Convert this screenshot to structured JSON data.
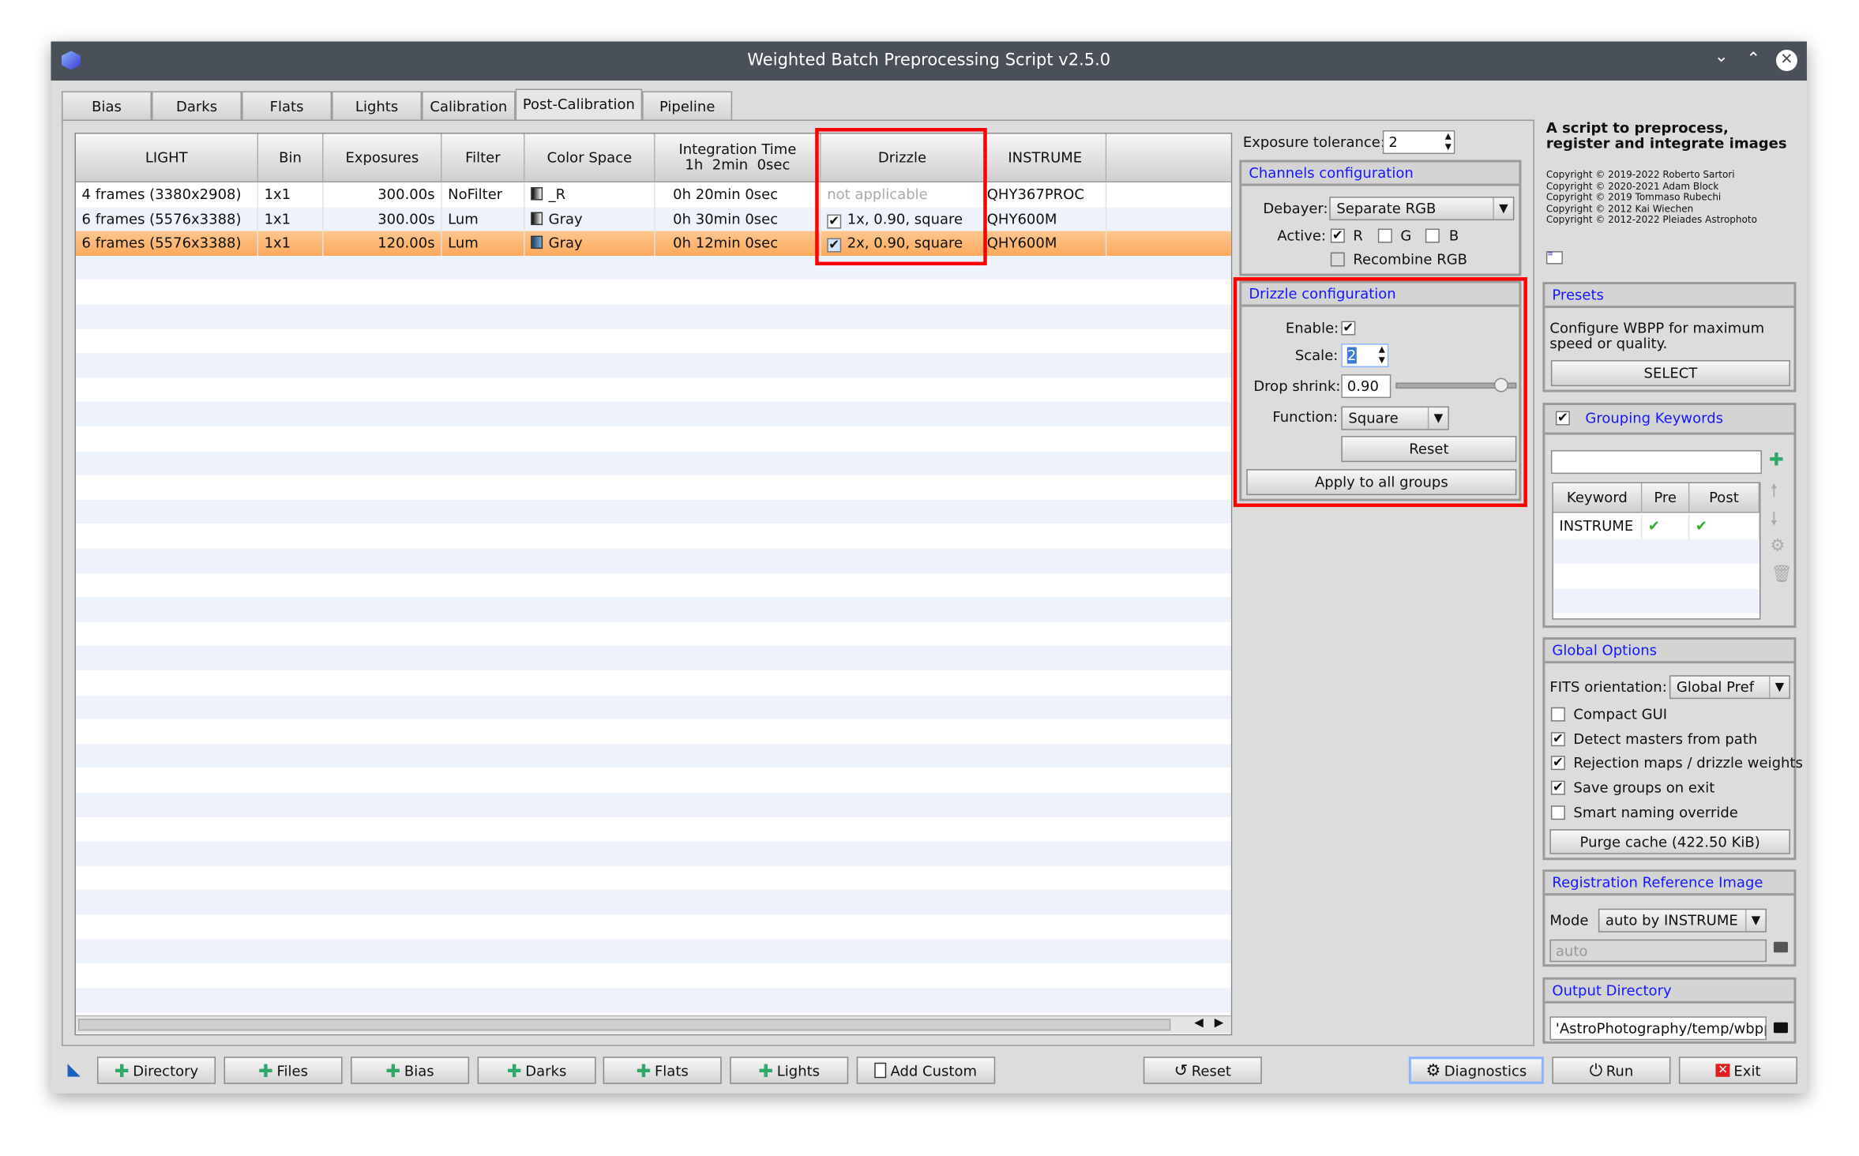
{
  "window": {
    "title": "Weighted Batch Preprocessing Script v2.5.0"
  },
  "tabs": [
    "Bias",
    "Darks",
    "Flats",
    "Lights",
    "Calibration",
    "Post-Calibration",
    "Pipeline"
  ],
  "active_tab": "Post-Calibration",
  "table": {
    "headers": [
      "LIGHT",
      "Bin",
      "Exposures",
      "Filter",
      "Color Space",
      "Integration Time\n1h  2min  0sec",
      "Drizzle",
      "INSTRUME",
      ""
    ],
    "rows": [
      {
        "light": "4 frames (3380x2908)",
        "bin": "1x1",
        "exposures": "300.00s",
        "filter": "NoFilter",
        "color_space": "_R",
        "integration": "0h 20min  0sec",
        "drizzle": "not applicable",
        "drizzle_checked": null,
        "instrume": "QHY367PROC",
        "selected": false
      },
      {
        "light": "6 frames (5576x3388)",
        "bin": "1x1",
        "exposures": "300.00s",
        "filter": "Lum",
        "color_space": "Gray",
        "integration": "0h 30min  0sec",
        "drizzle": "1x, 0.90, square",
        "drizzle_checked": true,
        "instrume": "QHY600M",
        "selected": false
      },
      {
        "light": "6 frames (5576x3388)",
        "bin": "1x1",
        "exposures": "120.00s",
        "filter": "Lum",
        "color_space": "Gray",
        "integration": "0h 12min  0sec",
        "drizzle": "2x, 0.90, square",
        "drizzle_checked": true,
        "instrume": "QHY600M",
        "selected": true
      }
    ]
  },
  "exposure_tolerance": {
    "label": "Exposure tolerance:",
    "value": "2"
  },
  "channels": {
    "title": "Channels configuration",
    "debayer_label": "Debayer:",
    "debayer_value": "Separate RGB",
    "active_label": "Active:",
    "r": "R",
    "g": "G",
    "b": "B",
    "r_checked": true,
    "g_checked": false,
    "b_checked": false,
    "recombine": "Recombine RGB",
    "recombine_checked": false
  },
  "drizzle": {
    "title": "Drizzle configuration",
    "enable_label": "Enable:",
    "enabled": true,
    "scale_label": "Scale:",
    "scale": "2",
    "shrink_label": "Drop shrink:",
    "shrink": "0.90",
    "shrink_slider": 0.9,
    "function_label": "Function:",
    "function": "Square",
    "reset": "Reset",
    "apply": "Apply to all groups"
  },
  "about": {
    "heading": "A script to preprocess, register and integrate images",
    "copyrights": [
      "Copyright © 2019-2022 Roberto Sartori",
      "Copyright © 2020-2021 Adam Block",
      "Copyright © 2019 Tommaso Rubechi",
      "Copyright © 2012 Kai Wiechen",
      "Copyright © 2012-2022 Pleiades Astrophoto"
    ]
  },
  "presets": {
    "title": "Presets",
    "text": "Configure WBPP for maximum speed or quality.",
    "select": "SELECT"
  },
  "grouping": {
    "title": "Grouping Keywords",
    "enabled": true,
    "input": "",
    "headers": [
      "Keyword",
      "Pre",
      "Post"
    ],
    "rows": [
      {
        "keyword": "INSTRUME",
        "pre": true,
        "post": true
      }
    ]
  },
  "global": {
    "title": "Global Options",
    "fits_label": "FITS orientation:",
    "fits_value": "Global Pref",
    "options": [
      {
        "label": "Compact GUI",
        "checked": false
      },
      {
        "label": "Detect masters from path",
        "checked": true
      },
      {
        "label": "Rejection maps / drizzle weights",
        "checked": true
      },
      {
        "label": "Save groups on exit",
        "checked": true
      },
      {
        "label": "Smart naming override",
        "checked": false
      }
    ],
    "purge": "Purge cache (422.50 KiB)"
  },
  "registration": {
    "title": "Registration Reference Image",
    "mode_label": "Mode",
    "mode_value": "auto by INSTRUME",
    "path": "auto"
  },
  "output": {
    "title": "Output Directory",
    "path": "'AstroPhotography/temp/wbpp"
  },
  "bottom": {
    "directory": "Directory",
    "files": "Files",
    "bias": "Bias",
    "darks": "Darks",
    "flats": "Flats",
    "lights": "Lights",
    "add_custom": "Add Custom",
    "reset": "Reset",
    "diagnostics": "Diagnostics",
    "run": "Run",
    "exit": "Exit"
  },
  "colors": {
    "selected_row": "#fdb771",
    "group_title": "#1515ff",
    "highlight": "#ff0000",
    "titlebar": "#4a5057"
  }
}
